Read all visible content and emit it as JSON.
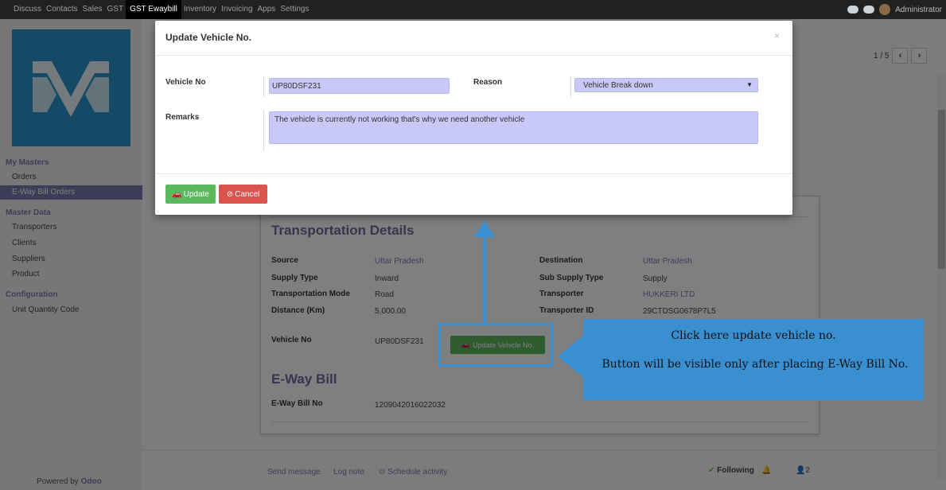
{
  "topnav": {
    "menu": [
      "Discuss",
      "Contacts",
      "Sales",
      "GST",
      "GST Ewaybill",
      "Inventory",
      "Invoicing",
      "Apps",
      "Settings"
    ],
    "active": "GST Ewaybill",
    "user": "Administrator"
  },
  "sidebar": {
    "sec_masters": "My Masters",
    "orders": "Orders",
    "eway_orders": "E-Way Bill Orders",
    "sec_master_data": "Master Data",
    "transporters": "Transporters",
    "clients": "Clients",
    "suppliers": "Suppliers",
    "product": "Product",
    "sec_config": "Configuration",
    "uqc": "Unit Quantity Code",
    "powered_prefix": "Powered by ",
    "powered_brand": "Odoo"
  },
  "pager": {
    "text": "1 / 5",
    "prev": "‹",
    "next": "›"
  },
  "sheet": {
    "transport_title": "Transportation Details",
    "source_lbl": "Source",
    "source_val": "Uttar Pradesh",
    "dest_lbl": "Destination",
    "dest_val": "Uttar Pradesh",
    "supply_type_lbl": "Supply Type",
    "supply_type_val": "Inward",
    "sub_supply_lbl": "Sub Supply Type",
    "sub_supply_val": "Supply",
    "mode_lbl": "Transportation Mode",
    "mode_val": "Road",
    "transporter_lbl": "Transporter",
    "transporter_val": "HUKKERI LTD",
    "distance_lbl": "Distance (Km)",
    "distance_val": "5,000.00",
    "transporter_id_lbl": "Transporter ID",
    "transporter_id_val": "29CTDSG0678P7L5",
    "vehicle_lbl": "Vehicle No",
    "vehicle_val": "UP80DSF231",
    "update_vehicle_btn": "Update Vehicle No.",
    "eway_title": "E-Way Bill",
    "eway_no_lbl": "E-Way Bill No",
    "eway_no_val": "1209042016022032"
  },
  "chatter": {
    "send_message": "Send message",
    "log_note": "Log note",
    "schedule": "Schedule activity",
    "following": "Following",
    "followers": "2"
  },
  "modal": {
    "title": "Update Vehicle No.",
    "close": "×",
    "vehicle_lbl": "Vehicle No",
    "vehicle_val": "UP80DSF231",
    "reason_lbl": "Reason",
    "reason_val": "Vehicle Break down",
    "remarks_lbl": "Remarks",
    "remarks_val": "The vehicle is currently not working that's why we need another vehicle",
    "update_btn": "Update",
    "cancel_btn": "Cancel"
  },
  "callout": {
    "line1": "Click here update vehicle no.",
    "line2": "Button will be visible only after placing E-Way Bill No."
  },
  "colors": {
    "brand": "#7c7bad",
    "callout": "#3a8fd1",
    "green": "#5cb85c",
    "red": "#d9534f",
    "logo": "#2a94cf"
  }
}
